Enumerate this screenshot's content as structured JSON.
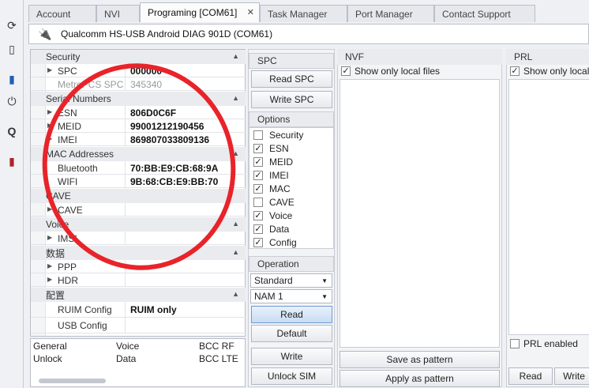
{
  "tabs": [
    {
      "label": "Account"
    },
    {
      "label": "NVI"
    },
    {
      "label": "Programing [COM61]",
      "active": true
    },
    {
      "label": "Task Manager"
    },
    {
      "label": "Port Manager"
    },
    {
      "label": "Contact Support"
    }
  ],
  "device": {
    "name": "Qualcomm HS-USB Android DIAG 901D (COM61)"
  },
  "toolbar_icons": [
    "refresh-icon",
    "phone-icon",
    "usb-icon",
    "power-icon",
    "qualcomm-icon",
    "sim-icon"
  ],
  "props": {
    "security": {
      "title": "Security",
      "spc": {
        "key": "SPC",
        "value": "000000"
      },
      "metro_spc": {
        "key": "MetroPCS SPC",
        "value": "345340"
      }
    },
    "serial": {
      "title": "Serial Numbers",
      "esn": {
        "key": "ESN",
        "value": "806D0C6F"
      },
      "meid": {
        "key": "MEID",
        "value": "99001212190456"
      },
      "imei": {
        "key": "IMEI",
        "value": "869807033809136"
      }
    },
    "mac": {
      "title": "MAC Addresses",
      "bluetooth": {
        "key": "Bluetooth",
        "value": "70:BB:E9:CB:68:9A"
      },
      "wifi": {
        "key": "WIFI",
        "value": "9B:68:CB:E9:BB:70"
      }
    },
    "cave": {
      "title": "CAVE",
      "cave": {
        "key": "CAVE",
        "value": ""
      }
    },
    "voice": {
      "title": "Voice",
      "imsi": {
        "key": "IMSI",
        "value": ""
      }
    },
    "data": {
      "title": "数据",
      "ppp": {
        "key": "PPP",
        "value": ""
      },
      "hdr": {
        "key": "HDR",
        "value": ""
      }
    },
    "config": {
      "title": "配置",
      "ruim": {
        "key": "RUIM Config",
        "value": "RUIM only"
      },
      "usb": {
        "key": "USB Config",
        "value": ""
      }
    }
  },
  "status": {
    "r1": [
      "General",
      "Voice",
      "BCC RF"
    ],
    "r2": [
      "Unlock",
      "Data",
      "BCC LTE"
    ]
  },
  "spc_section": {
    "title": "SPC",
    "read": "Read SPC",
    "write": "Write SPC"
  },
  "options": {
    "title": "Options",
    "items": [
      {
        "label": "Security",
        "checked": false
      },
      {
        "label": "ESN",
        "checked": true
      },
      {
        "label": "MEID",
        "checked": true
      },
      {
        "label": "IMEI",
        "checked": true
      },
      {
        "label": "MAC",
        "checked": true
      },
      {
        "label": "CAVE",
        "checked": false
      },
      {
        "label": "Voice",
        "checked": true
      },
      {
        "label": "Data",
        "checked": true
      },
      {
        "label": "Config",
        "checked": true
      }
    ]
  },
  "operation": {
    "title": "Operation",
    "mode": "Standard",
    "nam": "NAM 1",
    "read": "Read",
    "default": "Default",
    "write": "Write",
    "unlock": "Unlock SIM"
  },
  "nvf": {
    "title": "NVF",
    "filter": "Show only local files",
    "save": "Save as pattern",
    "apply": "Apply as pattern"
  },
  "prl": {
    "title": "PRL",
    "filter": "Show only local",
    "enabled": "PRL enabled",
    "read": "Read",
    "write": "Write"
  }
}
